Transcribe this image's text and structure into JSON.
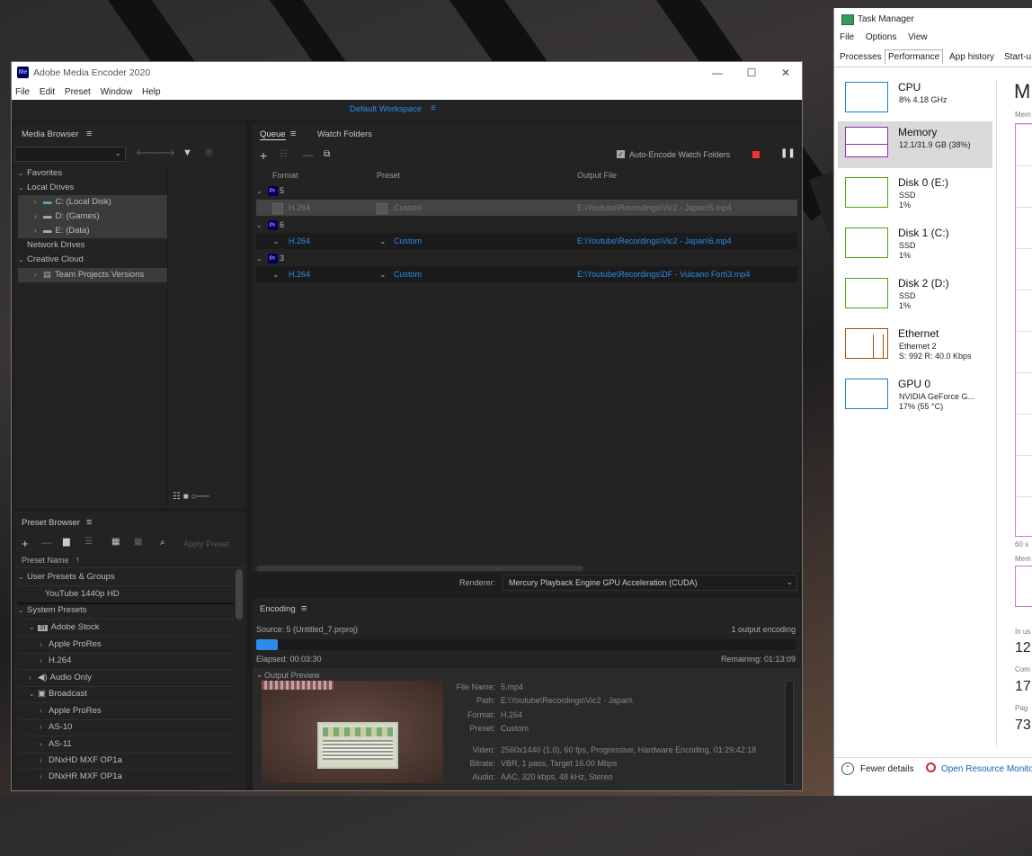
{
  "ame": {
    "title": "Adobe Media Encoder 2020",
    "logo": "Me",
    "window_controls": {
      "minimize": "—",
      "maximize": "☐",
      "close": "✕"
    },
    "menu": [
      "File",
      "Edit",
      "Preset",
      "Window",
      "Help"
    ],
    "workspace": "Default Workspace",
    "media_browser": {
      "title": "Media Browser",
      "tree": [
        {
          "label": "Favorites",
          "level": 0
        },
        {
          "label": "Local Drives",
          "level": 0
        },
        {
          "label": "C: (Local Disk)",
          "level": 1
        },
        {
          "label": "D: (Games)",
          "level": 1
        },
        {
          "label": "E: (Data)",
          "level": 1
        },
        {
          "label": "Network Drives",
          "level": 0
        },
        {
          "label": "Creative Cloud",
          "level": 0
        },
        {
          "label": "Team Projects Versions",
          "level": 1
        }
      ]
    },
    "queue": {
      "tabs": [
        "Queue",
        "Watch Folders"
      ],
      "auto_encode_label": "Auto-Encode Watch Folders",
      "columns": [
        "Format",
        "Preset",
        "Output File"
      ],
      "groups": [
        {
          "name": "5",
          "format": "H.264",
          "preset": "Custom",
          "output": "E:\\Youtube\\Recordings\\Vic2 - Japan\\5.mp4",
          "active": true
        },
        {
          "name": "6",
          "format": "H.264",
          "preset": "Custom",
          "output": "E:\\Youtube\\Recordings\\Vic2 - Japan\\6.mp4",
          "active": false
        },
        {
          "name": "3",
          "format": "H.264",
          "preset": "Custom",
          "output": "E:\\Youtube\\Recordings\\DF - Vulcano Fort\\3.mp4",
          "active": false
        }
      ],
      "badge": "Pr",
      "renderer_label": "Renderer:",
      "renderer_value": "Mercury Playback Engine GPU Acceleration (CUDA)"
    },
    "preset_browser": {
      "title": "Preset Browser",
      "apply_label": "Apply Preset",
      "column": "Preset Name",
      "rows": [
        {
          "label": "User Presets & Groups",
          "level": 0
        },
        {
          "label": "YouTube 1440p HD",
          "level": 2
        },
        {
          "label": "System Presets",
          "level": 0
        },
        {
          "label": "Adobe Stock",
          "level": 1
        },
        {
          "label": "Apple ProRes",
          "level": 2
        },
        {
          "label": "H.264",
          "level": 2
        },
        {
          "label": "Audio Only",
          "level": 1
        },
        {
          "label": "Broadcast",
          "level": 1
        },
        {
          "label": "Apple ProRes",
          "level": 2
        },
        {
          "label": "AS-10",
          "level": 2
        },
        {
          "label": "AS-11",
          "level": 2
        },
        {
          "label": "DNxHD MXF OP1a",
          "level": 2
        },
        {
          "label": "DNxHR MXF OP1a",
          "level": 2
        }
      ]
    },
    "encoding": {
      "title": "Encoding",
      "source": "Source: 5 (Untitled_7.prproj)",
      "outputs": "1 output encoding",
      "progress": 0.04,
      "elapsed": "Elapsed: 00:03:30",
      "remaining": "Remaining: 01:13:09",
      "preview_label": "Output Preview",
      "details": [
        {
          "k": "File Name:",
          "v": "5.mp4"
        },
        {
          "k": "Path:",
          "v": "E:\\Youtube\\Recordings\\Vic2 - Japan\\"
        },
        {
          "k": "Format:",
          "v": "H.264"
        },
        {
          "k": "Preset:",
          "v": "Custom"
        },
        {
          "k": "Video:",
          "v": "2560x1440 (1.0), 60 fps, Progressive, Hardware Encoding, 01:29:42:18"
        },
        {
          "k": "Bitrate:",
          "v": "VBR, 1 pass, Target 16.00 Mbps"
        },
        {
          "k": "Audio:",
          "v": "AAC, 320 kbps, 48 kHz, Stereo"
        }
      ]
    }
  },
  "tm": {
    "title": "Task Manager",
    "menu": [
      "File",
      "Options",
      "View"
    ],
    "tabs": [
      "Processes",
      "Performance",
      "App history",
      "Start-u"
    ],
    "items": [
      {
        "name": "CPU",
        "s1": "8% 4.18 GHz",
        "s2": "",
        "color": "#1a7fc8"
      },
      {
        "name": "Memory",
        "s1": "12.1/31.9 GB (38%)",
        "s2": "",
        "color": "#9528b4"
      },
      {
        "name": "Disk 0 (E:)",
        "s1": "SSD",
        "s2": "1%",
        "color": "#4da60c"
      },
      {
        "name": "Disk 1 (C:)",
        "s1": "SSD",
        "s2": "1%",
        "color": "#4da60c"
      },
      {
        "name": "Disk 2 (D:)",
        "s1": "SSD",
        "s2": "1%",
        "color": "#4da60c"
      },
      {
        "name": "Ethernet",
        "s1": "Ethernet 2",
        "s2": "S: 992 R: 40.0 Kbps",
        "color": "#a74f01"
      },
      {
        "name": "GPU 0",
        "s1": "NVIDIA GeForce G...",
        "s2": "17% (55 °C)",
        "color": "#1a7fc8"
      }
    ],
    "heading": "M",
    "mem_label": "Mem",
    "sec_label": "60 s",
    "mem_label2": "Mem",
    "stats": [
      {
        "k": "In us",
        "v": "12"
      },
      {
        "k": "Com",
        "v": "17"
      },
      {
        "k": "Pag",
        "v": "73"
      }
    ],
    "fewer_details": "Fewer details",
    "open_resource": "Open Resource Monito"
  }
}
